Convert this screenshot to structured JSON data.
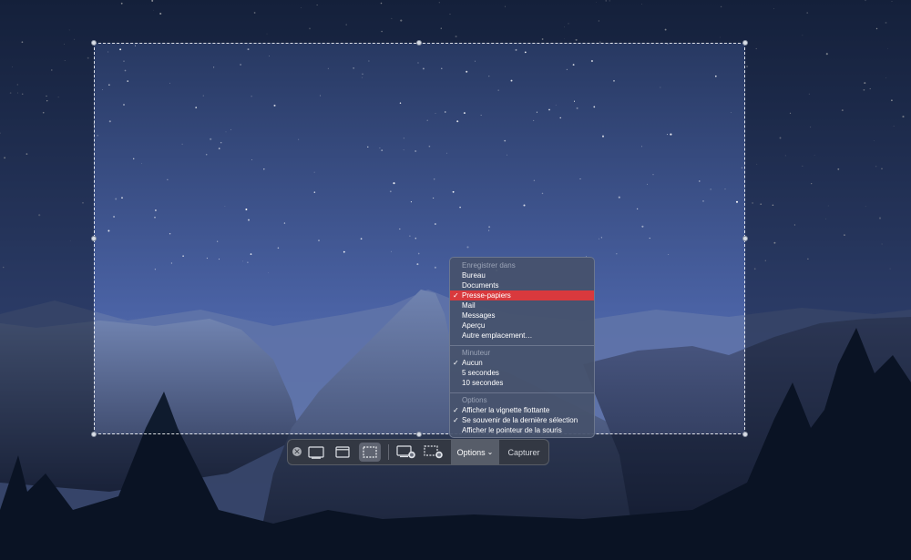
{
  "toolbar": {
    "close_icon": "x-circle-icon",
    "options_label": "Options",
    "options_chevron": "⌄",
    "capture_label": "Capturer"
  },
  "menu": {
    "save_header": "Enregistrer dans",
    "save_items": [
      {
        "label": "Bureau",
        "checked": false
      },
      {
        "label": "Documents",
        "checked": false
      },
      {
        "label": "Presse-papiers",
        "checked": true
      },
      {
        "label": "Mail",
        "checked": false
      },
      {
        "label": "Messages",
        "checked": false
      },
      {
        "label": "Aperçu",
        "checked": false
      },
      {
        "label": "Autre emplacement…",
        "checked": false
      }
    ],
    "timer_header": "Minuteur",
    "timer_items": [
      {
        "label": "Aucun",
        "checked": true
      },
      {
        "label": "5 secondes",
        "checked": false
      },
      {
        "label": "10 secondes",
        "checked": false
      }
    ],
    "options_header": "Options",
    "options_items": [
      {
        "label": "Afficher la vignette flottante",
        "checked": true
      },
      {
        "label": "Se souvenir de la dernière sélection",
        "checked": true
      },
      {
        "label": "Afficher le pointeur de la souris",
        "checked": false
      }
    ],
    "check_glyph": "✓"
  },
  "colors": {
    "highlight": "#d9393d",
    "sky_top": "#243560",
    "sky_bottom": "#6a84c6"
  }
}
